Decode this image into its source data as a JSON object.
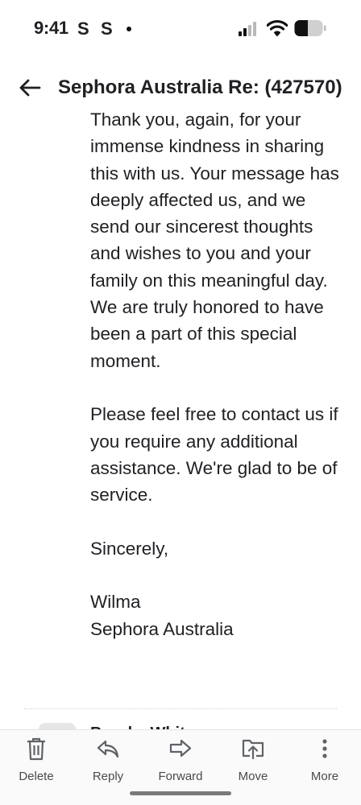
{
  "status_bar": {
    "time": "9:41",
    "notification_icons": [
      "S",
      "S"
    ]
  },
  "header": {
    "subject": "Sephora Australia Re: (427570)"
  },
  "message": {
    "paragraphs": [
      "Thank you, again, for your immense kindness in sharing this with us. Your message has deeply affected us, and we send our sincerest thoughts and wishes to you and your family on this meaningful day. We are truly honored to have been a part of this special moment.",
      "Please feel free to contact us if you require any additional assistance. We're glad to be of service.",
      "Sincerely,",
      "Wilma\nSephora Australia"
    ]
  },
  "next_message": {
    "sender": "Brooke White"
  },
  "toolbar": {
    "delete": "Delete",
    "reply": "Reply",
    "forward": "Forward",
    "move": "Move",
    "more": "More"
  },
  "icons": [
    "back-arrow-icon",
    "cellular-signal-icon",
    "wifi-icon",
    "battery-icon",
    "trash-icon",
    "reply-arrow-icon",
    "forward-arrow-icon",
    "move-folder-icon",
    "more-vertical-icon"
  ],
  "colors": {
    "text": "#202124",
    "toolbar_icon": "#5f6368",
    "toolbar_bg": "#fafafa"
  }
}
